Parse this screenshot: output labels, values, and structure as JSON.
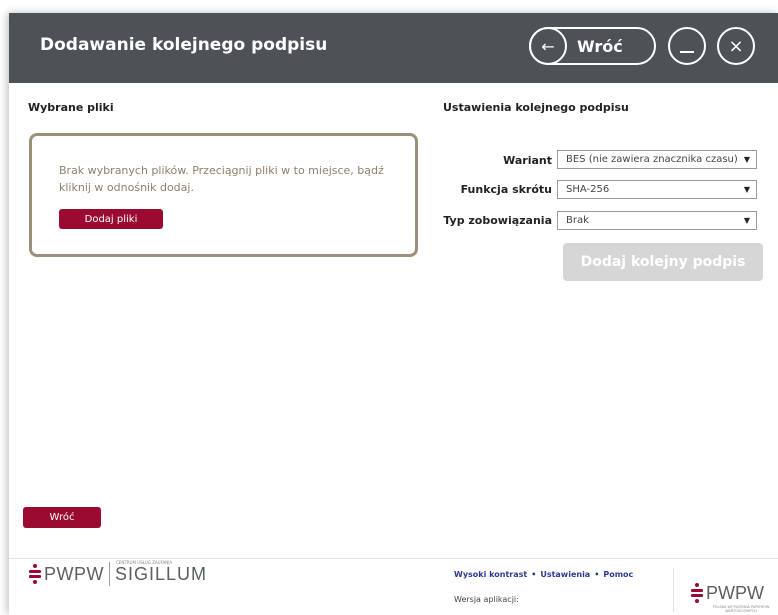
{
  "header": {
    "title": "Dodawanie kolejnego podpisu",
    "back_label": "Wróć",
    "back_arrow": "←",
    "minimize_glyph": "__",
    "close_glyph": "×",
    "bg_color": "#4c5256"
  },
  "left": {
    "section_title": "Wybrane pliki",
    "dropzone_text": "Brak wybranych plików. Przeciągnij pliki w to miejsce, bądź kliknij w odnośnik dodaj.",
    "add_files_label": "Dodaj pliki",
    "back_button_label": "Wróć"
  },
  "right": {
    "section_title": "Ustawienia kolejnego podpisu",
    "variant_label": "Wariant",
    "variant_value": "BES (nie zawiera znacznika czasu)",
    "hash_label": "Funkcja skrótu",
    "hash_value": "SHA-256",
    "commitment_label": "Typ zobowiązania",
    "commitment_value": "Brak",
    "dropdown_glyph": "▼",
    "add_signature_label": "Dodaj kolejny podpis"
  },
  "footer": {
    "logo_left_pwpw": "PWPW",
    "logo_left_sigillum": "SIGILLUM",
    "logo_left_tagline": "CENTRUM USŁUG ZAUFANIA",
    "link_contrast": "Wysoki kontrast",
    "link_settings": "Ustawienia",
    "link_help": "Pomoc",
    "version_label": "Wersja aplikacji:",
    "logo_right_pwpw": "PWPW",
    "logo_right_tagline": "POLSKA WYTWÓRNIA PAPIERÓW WARTOŚCIOWYCH"
  },
  "colors": {
    "accent": "#9b0b31",
    "dropzone_border": "#9c8f7c",
    "link": "#2d3a8c",
    "disabled": "#d6d6d6"
  }
}
